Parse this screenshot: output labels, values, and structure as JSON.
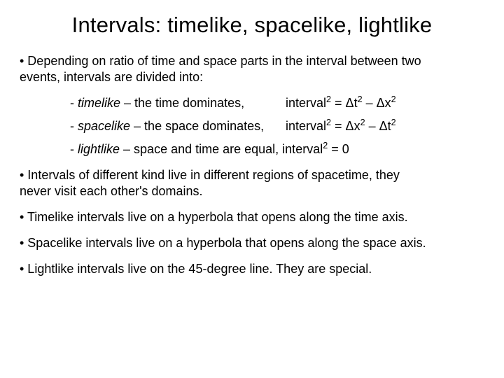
{
  "title": "Intervals: timelike, spacelike, lightlike",
  "intro_a": "• Depending on ratio of time and space parts in the interval between two",
  "intro_b": "events, intervals are divided into:",
  "sub": {
    "timelike_label_a": "- ",
    "timelike_label_b": "timelike",
    "timelike_label_c": " – the time dominates,",
    "timelike_eq_a": "interval",
    "timelike_eq_b": " = Δt",
    "timelike_eq_c": " – Δx",
    "spacelike_label_a": "- ",
    "spacelike_label_b": "spacelike",
    "spacelike_label_c": " – the space dominates,",
    "spacelike_eq_a": "interval",
    "spacelike_eq_b": " = Δx",
    "spacelike_eq_c": " – Δt",
    "lightlike_label_a": "- ",
    "lightlike_label_b": "lightlike",
    "lightlike_label_c": " – space and time are equal, interval",
    "lightlike_eq_c": " = 0"
  },
  "sup2": "2",
  "p2a": "• Intervals of different kind live in different regions of spacetime, they",
  "p2b": "never visit each other's domains.",
  "p3": "• Timelike intervals live on a hyperbola that opens along the time axis.",
  "p4": "• Spacelike intervals live on a hyperbola that opens along the space axis.",
  "p5": "• Lightlike intervals live on the 45-degree line. They are special."
}
